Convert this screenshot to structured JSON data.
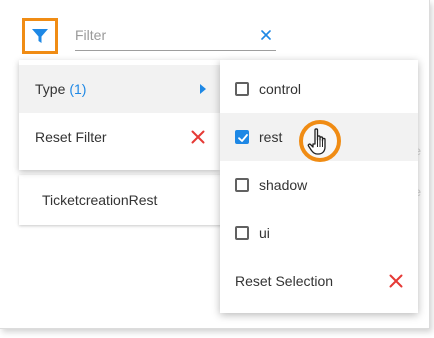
{
  "colors": {
    "accent": "#1e88e5",
    "highlight": "#f08c14",
    "danger": "#e53935"
  },
  "filter_bar": {
    "icon": "funnel-icon",
    "placeholder": "Filter",
    "value": "",
    "clear_icon": "close-icon"
  },
  "filter_menu": {
    "items": [
      {
        "label": "Type",
        "count": "(1)",
        "icon": "chevron-right-icon"
      },
      {
        "label": "Reset Filter",
        "icon": "close-icon"
      }
    ]
  },
  "type_menu": {
    "options": [
      {
        "label": "control",
        "checked": false
      },
      {
        "label": "rest",
        "checked": true
      },
      {
        "label": "shadow",
        "checked": false
      },
      {
        "label": "ui",
        "checked": false
      }
    ],
    "reset_label": "Reset Selection",
    "reset_icon": "close-icon"
  },
  "list": {
    "rows": [
      {
        "name": "TicketcreationRest"
      }
    ]
  },
  "cursor": {
    "icon": "hand-pointer-icon"
  }
}
